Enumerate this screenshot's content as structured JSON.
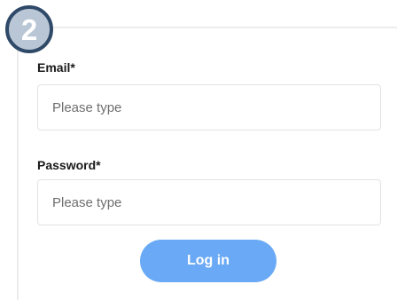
{
  "step": {
    "number": "2"
  },
  "form": {
    "email": {
      "label": "Email*",
      "placeholder": "Please type",
      "value": ""
    },
    "password": {
      "label": "Password*",
      "placeholder": "Please type",
      "value": ""
    },
    "login_label": "Log in"
  },
  "colors": {
    "button_bg": "#6aa9f5",
    "badge_fill": "#b9c6d5",
    "badge_border": "#2f4968"
  }
}
